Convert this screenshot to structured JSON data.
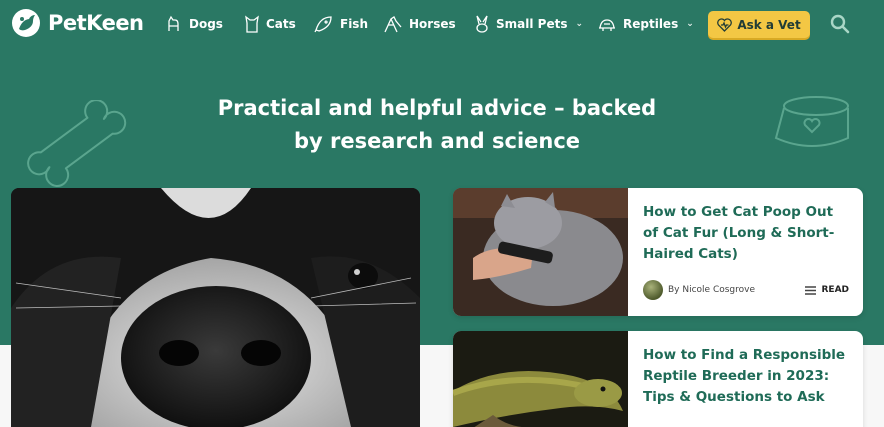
{
  "brand": {
    "name": "PetKeen",
    "color": "#2a7864",
    "accent": "#f3c744"
  },
  "nav": {
    "items": [
      {
        "label": "Dogs",
        "icon": "dog-icon"
      },
      {
        "label": "Cats",
        "icon": "cat-icon"
      },
      {
        "label": "Fish",
        "icon": "fish-icon"
      },
      {
        "label": "Horses",
        "icon": "horse-icon"
      },
      {
        "label": "Small Pets",
        "icon": "rabbit-icon",
        "dropdown": true
      },
      {
        "label": "Reptiles",
        "icon": "turtle-icon",
        "dropdown": true
      }
    ],
    "cta_label": "Ask a Vet",
    "cta_icon": "heart-icon",
    "search_icon": "search-icon"
  },
  "hero": {
    "headline_line1": "Practical and helpful advice – backed",
    "headline_line2": "by research and science"
  },
  "articles": [
    {
      "title": "How to Get Cat Poop Out of Cat Fur (Long & Short-Haired Cats)",
      "author": "By Nicole Cosgrove",
      "read_label": "READ"
    },
    {
      "title": "How to Find a Responsible Reptile Breeder in 2023: Tips & Questions to Ask"
    }
  ]
}
